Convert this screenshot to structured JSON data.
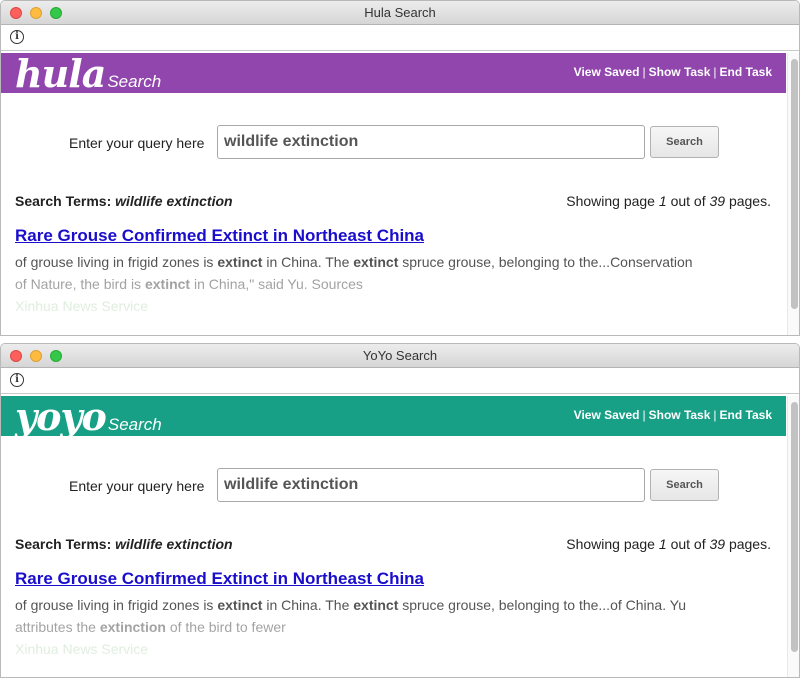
{
  "windows": [
    {
      "title": "Hula Search",
      "logo_main": "hula",
      "logo_sub": "Search",
      "brand_color": "#9146ad",
      "nav": {
        "view_saved": "View Saved",
        "show_task": "Show Task",
        "end_task": "End Task",
        "separator": "|"
      },
      "query_label": "Enter your query here",
      "query_value": "wildlife extinction",
      "search_button": "Search",
      "terms_label": "Search Terms:",
      "terms_value": "wildlife extinction",
      "paging": {
        "prefix": "Showing page",
        "current": "1",
        "middle": "out of",
        "total": "39",
        "suffix": "pages."
      },
      "result": {
        "title": "Rare Grouse Confirmed Extinct in Northeast China",
        "snippet_line1": [
          {
            "t": "of grouse living in frigid zones is ",
            "b": false
          },
          {
            "t": "extinct",
            "b": true
          },
          {
            "t": " in China. The ",
            "b": false
          },
          {
            "t": "extinct",
            "b": true
          },
          {
            "t": " spruce grouse, belonging to the...Conservation",
            "b": false
          }
        ],
        "snippet_line2": [
          {
            "t": "of Nature, the bird is ",
            "b": false
          },
          {
            "t": "extinct",
            "b": true
          },
          {
            "t": " in China,\" said Yu. Sources",
            "b": false
          }
        ],
        "source": "Xinhua News Service"
      }
    },
    {
      "title": "YoYo Search",
      "logo_main": "yoyo",
      "logo_sub": "Search",
      "brand_color": "#17a085",
      "nav": {
        "view_saved": "View Saved",
        "show_task": "Show Task",
        "end_task": "End Task",
        "separator": "|"
      },
      "query_label": "Enter your query here",
      "query_value": "wildlife extinction",
      "search_button": "Search",
      "terms_label": "Search Terms:",
      "terms_value": "wildlife extinction",
      "paging": {
        "prefix": "Showing page",
        "current": "1",
        "middle": "out of",
        "total": "39",
        "suffix": "pages."
      },
      "result": {
        "title": "Rare Grouse Confirmed Extinct in Northeast China",
        "snippet_line1": [
          {
            "t": "of grouse living in frigid zones is ",
            "b": false
          },
          {
            "t": "extinct",
            "b": true
          },
          {
            "t": " in China. The ",
            "b": false
          },
          {
            "t": "extinct",
            "b": true
          },
          {
            "t": " spruce grouse, belonging to the...of China. Yu",
            "b": false
          }
        ],
        "snippet_line2": [
          {
            "t": "attributes the ",
            "b": false
          },
          {
            "t": "extinction",
            "b": true
          },
          {
            "t": " of the bird to fewer",
            "b": false
          }
        ],
        "source": "Xinhua News Service"
      }
    }
  ]
}
